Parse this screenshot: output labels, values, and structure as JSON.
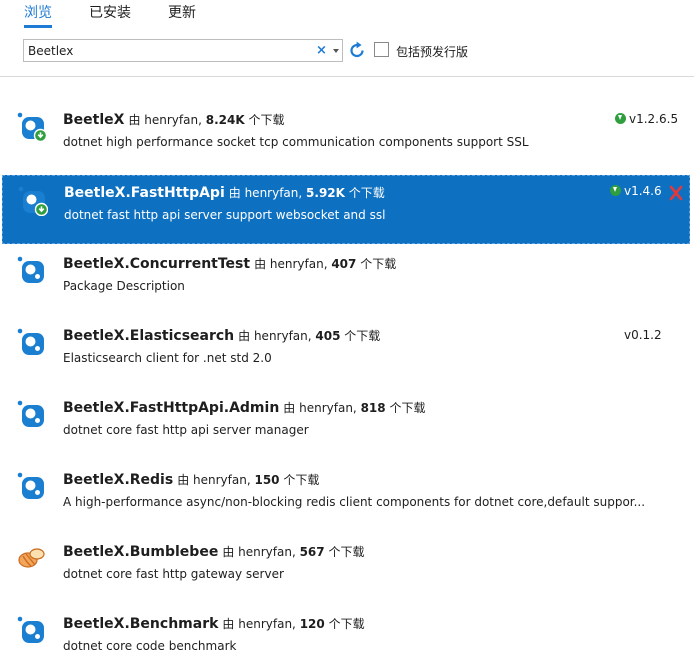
{
  "tabs": {
    "browse": "浏览",
    "installed": "已安装",
    "updates": "更新"
  },
  "search": {
    "value": "Beetlex",
    "clear_icon": "×"
  },
  "prerelease_label": "包括预发行版",
  "colors": {
    "accent": "#1e7bd4",
    "selected_bg": "#0e70c0",
    "update_green": "#2e9e3e",
    "uninstall_red": "#d9343a"
  },
  "packages": [
    {
      "name": "BeetleX",
      "by": "由 henryfan,",
      "downloads": "8.24K",
      "downloads_suffix": "个下载",
      "description": "dotnet high performance socket tcp communication components support SSL",
      "version": "v1.2.6.5",
      "icon": "nuget-installed-icon"
    },
    {
      "name": "BeetleX.FastHttpApi",
      "by": "由 henryfan,",
      "downloads": "5.92K",
      "downloads_suffix": "个下载",
      "description": "dotnet fast http api server support websocket and ssl",
      "version": "v1.4.6",
      "icon": "nuget-installed-icon"
    },
    {
      "name": "BeetleX.ConcurrentTest",
      "by": "由 henryfan,",
      "downloads": "407",
      "downloads_suffix": "个下载",
      "description": "Package Description",
      "version": "",
      "icon": "nuget-icon"
    },
    {
      "name": "BeetleX.Elasticsearch",
      "by": "由 henryfan,",
      "downloads": "405",
      "downloads_suffix": "个下载",
      "description": "Elasticsearch client for .net std 2.0",
      "version": "v0.1.2",
      "icon": "nuget-icon"
    },
    {
      "name": "BeetleX.FastHttpApi.Admin",
      "by": "由 henryfan,",
      "downloads": "818",
      "downloads_suffix": "个下载",
      "description": "dotnet core fast http api server manager",
      "version": "",
      "icon": "nuget-icon"
    },
    {
      "name": "BeetleX.Redis",
      "by": "由 henryfan,",
      "downloads": "150",
      "downloads_suffix": "个下载",
      "description": "A high-performance async/non-blocking  redis client components for dotnet core,default suppor...",
      "version": "",
      "icon": "nuget-icon"
    },
    {
      "name": "BeetleX.Bumblebee",
      "by": "由 henryfan,",
      "downloads": "567",
      "downloads_suffix": "个下载",
      "description": "dotnet core fast http gateway server",
      "version": "",
      "icon": "bee-icon"
    },
    {
      "name": "BeetleX.Benchmark",
      "by": "由 henryfan,",
      "downloads": "120",
      "downloads_suffix": "个下载",
      "description": "dotnet core code benchmark",
      "version": "",
      "icon": "nuget-icon"
    }
  ]
}
